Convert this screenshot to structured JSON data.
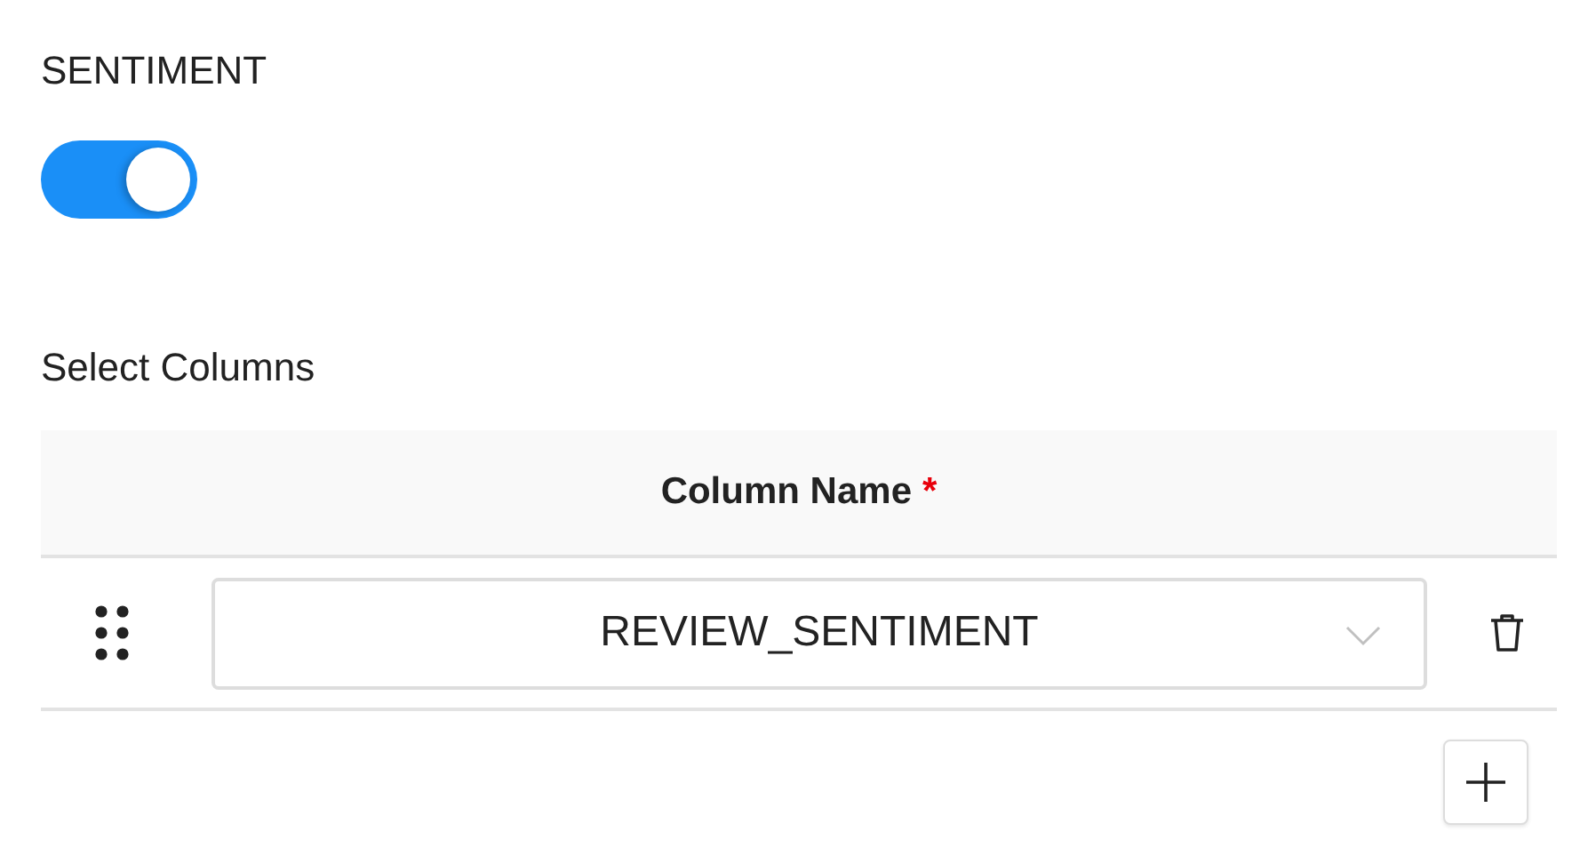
{
  "sentiment": {
    "label": "SENTIMENT",
    "on": true
  },
  "columns_section": {
    "label": "Select Columns",
    "table": {
      "columns": [
        {
          "label": "Column Name",
          "required_mark": "*"
        }
      ],
      "rows": [
        {
          "value": "REVIEW_SENTIMENT"
        }
      ]
    }
  }
}
